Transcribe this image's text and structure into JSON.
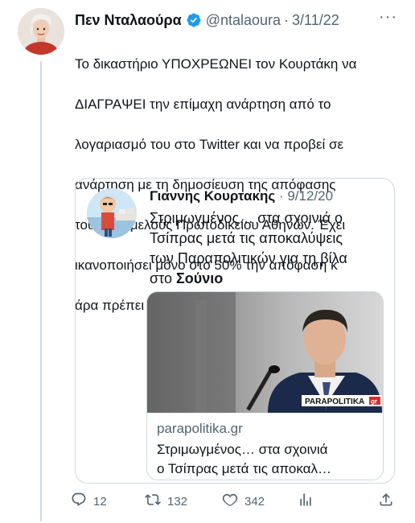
{
  "tweet": {
    "display_name": "Πεν Νταλαούρα",
    "handle": "@ntalaoura",
    "separator": "·",
    "date": "3/11/22",
    "more": "···",
    "lines": [
      "Το δικαστήριο ΥΠΟΧΡΕΩΝΕΙ τον Κουρτάκη να",
      "ΔΙΑΓΡΑΨΕΙ την επίμαχη ανάρτηση από το",
      "λογαριασμό του στο Twitter και να προβεί σε",
      "ανάρτηση με τη δημοσίευση της απόφασης",
      "του Πολυμελούς Πρωτοδικείου Αθηνών. Έχει",
      "ικανοποιήσει μόνο στο 50% την απόφαση κ",
      "άρα πρέπει να διαταχθεί η σύλληψη του"
    ],
    "accent": "#1d9bf0"
  },
  "quote": {
    "display_name": "Γιαννης Κουρτακης",
    "separator": "·",
    "date": "9/12/20",
    "text_lines": [
      "Στριμωγμένος… στα σχοινιά ο",
      "Τσίπρας μετά τις αποκαλύψεις",
      "των Παραπολιτικών για τη βίλα"
    ],
    "text_last_plain": "στο ",
    "text_last_bold": "Σούνιο",
    "link": {
      "domain": "parapolitika.gr",
      "title_line1": "Στριμωγμένος… στα σχοινιά",
      "title_line2": "ο Τσίπρας μετά τις αποκαλ…",
      "logo_text": "PARAPOLITIKA",
      "logo_suffix": "gr"
    }
  },
  "actions": {
    "replies": "12",
    "retweets": "132",
    "likes": "342"
  },
  "icons": {
    "verified": "verified-badge-icon",
    "reply": "reply-icon",
    "retweet": "retweet-icon",
    "like": "heart-icon",
    "views": "analytics-icon",
    "share": "share-icon"
  }
}
